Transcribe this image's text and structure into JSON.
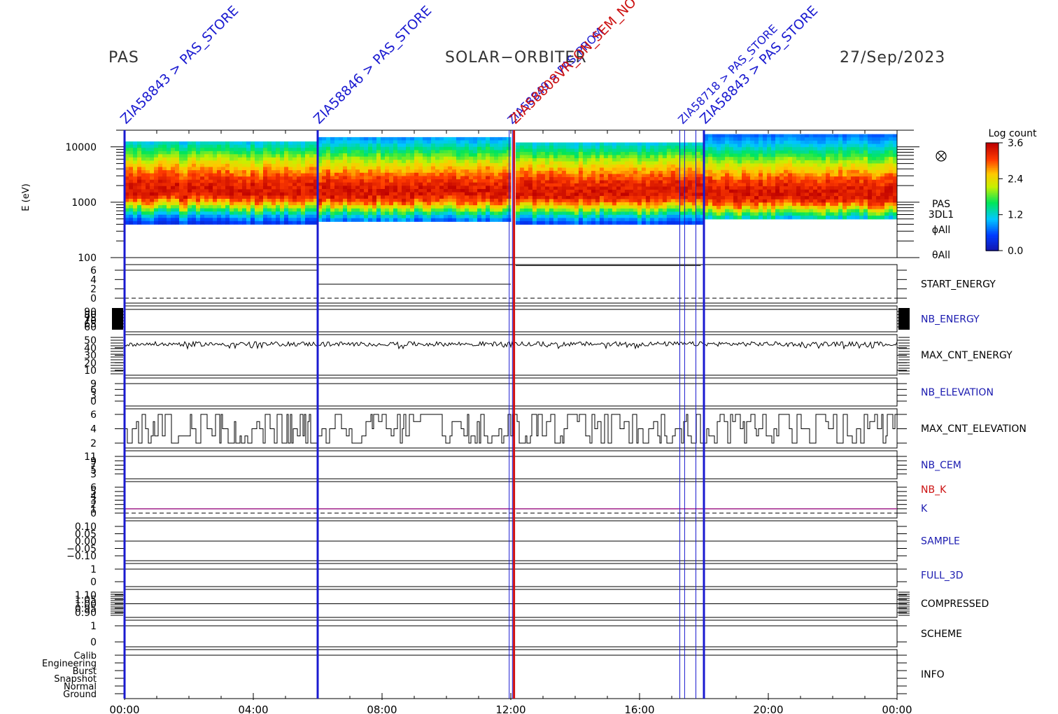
{
  "header": {
    "left": "PAS",
    "center": "SOLAR−ORBITER",
    "right": "27/Sep/2023"
  },
  "colors": {
    "frame": "#000000",
    "blue_label": "#1a1ab0",
    "red_label": "#cc1111",
    "event_blue": "#1a1ad0",
    "event_red": "#d01010"
  },
  "colorbar": {
    "title": "Log count",
    "ticks": [
      "3.6",
      "2.4",
      "1.2",
      "0.0"
    ]
  },
  "spectrogram_side_labels": [
    "PAS",
    "3DL1",
    "ϕAll",
    "θAll"
  ],
  "event_annotations": {
    "note": "rotated blue/red text labels at event lines",
    "labels": [
      {
        "text": "ZIA58843 > PAS_STORE",
        "color": "blue"
      },
      {
        "text": "ZIA58846 > PAS_STORE",
        "color": "blue"
      },
      {
        "text": "ZIA58849 > PAS_PROM",
        "color": "blue"
      },
      {
        "text": "ZIA58808VR_ON_SEM_NO",
        "color": "red"
      },
      {
        "text": "ZIA58718 > PAS_STORE",
        "color": "blue"
      },
      {
        "text": "ZIA58843 > PAS_STORE",
        "color": "blue"
      }
    ]
  },
  "chart_data": {
    "type": "stacked-timeseries",
    "x_axis": {
      "ticks": [
        "00:00",
        "04:00",
        "08:00",
        "12:00",
        "16:00",
        "20:00",
        "00:00"
      ],
      "range_hours": [
        0,
        24
      ]
    },
    "event_lines_hours": [
      {
        "t": 0.0,
        "color": "blue",
        "weight": "thick"
      },
      {
        "t": 6.0,
        "color": "blue",
        "weight": "thick"
      },
      {
        "t": 11.95,
        "color": "blue",
        "weight": "thin"
      },
      {
        "t": 12.05,
        "color": "blue",
        "weight": "thin"
      },
      {
        "t": 12.1,
        "color": "red",
        "weight": "thick"
      },
      {
        "t": 17.25,
        "color": "blue",
        "weight": "thin"
      },
      {
        "t": 17.4,
        "color": "blue",
        "weight": "thin"
      },
      {
        "t": 17.75,
        "color": "blue",
        "weight": "thin"
      },
      {
        "t": 18.0,
        "color": "blue",
        "weight": "thick"
      }
    ],
    "panels": [
      {
        "id": "spectrogram",
        "ylabel": "E (eV)",
        "y_scale": "log",
        "yticks": [
          "10000",
          "1000",
          "100"
        ],
        "y_range": [
          100,
          20000
        ],
        "segments": [
          {
            "t0": 0.0,
            "t1": 6.0,
            "emin": 400,
            "emax": 12500,
            "epeak": 1500
          },
          {
            "t0": 6.0,
            "t1": 12.0,
            "emin": 450,
            "emax": 15000,
            "epeak": 1450
          },
          {
            "t0": 12.15,
            "t1": 18.0,
            "emin": 400,
            "emax": 12000,
            "epeak": 1400
          },
          {
            "t0": 18.0,
            "t1": 24.0,
            "emin": 500,
            "emax": 17000,
            "epeak": 1300
          }
        ]
      },
      {
        "id": "start_energy",
        "label": "START_ENERGY",
        "label_color": "black",
        "yticks": [
          "6",
          "4",
          "2",
          "0"
        ],
        "values": [
          {
            "t0": 0,
            "t1": 6,
            "v": 6
          },
          {
            "t0": 6,
            "t1": 12,
            "v": 3
          },
          {
            "t0": 12.15,
            "t1": 17.9,
            "v": 7
          }
        ],
        "dashed_zero": true
      },
      {
        "id": "nb_energy",
        "label": "NB_ENERGY",
        "label_color": "blue",
        "yticks": [
          "90",
          "80",
          "75",
          "70",
          "65",
          "60"
        ],
        "constant": 96
      },
      {
        "id": "max_cnt_energy",
        "label": "MAX_CNT_ENERGY",
        "label_color": "black",
        "yticks": [
          "50",
          "40",
          "30",
          "20",
          "10"
        ],
        "mean": 45,
        "noise": 3
      },
      {
        "id": "nb_elevation",
        "label": "NB_ELEVATION",
        "label_color": "blue",
        "yticks": [
          "9",
          "6",
          "3",
          "0"
        ],
        "constant": 9
      },
      {
        "id": "max_cnt_elevation",
        "label": "MAX_CNT_ELEVATION",
        "label_color": "black",
        "yticks": [
          "6",
          "4",
          "2"
        ],
        "levels": [
          2,
          3,
          4,
          5,
          6
        ]
      },
      {
        "id": "nb_cem",
        "label": "NB_CEM",
        "label_color": "blue",
        "yticks": [
          "11",
          "9",
          "7",
          "5",
          "3"
        ],
        "constant": 11
      },
      {
        "id": "nb_k",
        "label": "NB_K",
        "label_color": "red",
        "k_label": "K",
        "k_label_color": "blue",
        "yticks": [
          "6",
          "5",
          "4",
          "3",
          "2",
          "1",
          "0"
        ],
        "constant": 1,
        "dashed_zero": true
      },
      {
        "id": "sample",
        "label": "SAMPLE",
        "label_color": "blue",
        "yticks": [
          "0.10",
          "0.05",
          "0.00",
          "−0.05",
          "−0.10"
        ],
        "constant": 0
      },
      {
        "id": "full_3d",
        "label": "FULL_3D",
        "label_color": "blue",
        "yticks": [
          "1",
          "0"
        ],
        "constant": 1
      },
      {
        "id": "compressed",
        "label": "COMPRESSED",
        "label_color": "black",
        "yticks": [
          "1.10",
          "1.05",
          "1.00",
          "0.95",
          "0.90"
        ],
        "constant": 1
      },
      {
        "id": "scheme",
        "label": "SCHEME",
        "label_color": "black",
        "yticks": [
          "1",
          "0"
        ],
        "constant": 1
      },
      {
        "id": "info",
        "label": "INFO",
        "label_color": "black",
        "yticks": [
          "Calib",
          "Engineering",
          "Burst",
          "Snapshot",
          "Normal",
          "Ground"
        ],
        "constant": "Calib"
      }
    ]
  }
}
